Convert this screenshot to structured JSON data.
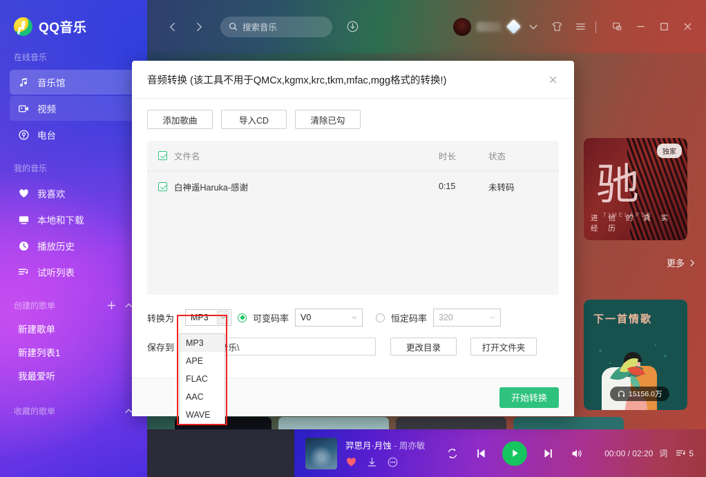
{
  "app": {
    "brand": "QQ音乐",
    "logo_icon": "qq-music-logo"
  },
  "sidebar": {
    "sections": [
      {
        "title": "在线音乐",
        "items": [
          {
            "label": "音乐馆",
            "icon": "music-note-icon",
            "state": "active"
          },
          {
            "label": "视频",
            "icon": "video-icon",
            "state": "semi"
          },
          {
            "label": "电台",
            "icon": "radio-icon",
            "state": "normal"
          }
        ]
      },
      {
        "title": "我的音乐",
        "items": [
          {
            "label": "我喜欢",
            "icon": "heart-icon",
            "state": "normal"
          },
          {
            "label": "本地和下载",
            "icon": "monitor-icon",
            "state": "normal"
          },
          {
            "label": "播放历史",
            "icon": "clock-icon",
            "state": "normal"
          },
          {
            "label": "试听列表",
            "icon": "playlist-icon",
            "state": "normal"
          }
        ]
      },
      {
        "title": "创建的歌单",
        "actions": [
          "plus-icon",
          "chevron-up-icon"
        ],
        "plain_items": [
          "新建歌单",
          "新建列表1",
          "我最爱听"
        ]
      },
      {
        "title": "收藏的歌单",
        "actions": [
          "chevron-up-icon"
        ],
        "plain_items": []
      }
    ]
  },
  "topbar": {
    "back_icon": "chevron-left-icon",
    "forward_icon": "chevron-right-icon",
    "search_placeholder": "搜索音乐",
    "search_icon": "search-icon",
    "download_icon": "download-circle-icon",
    "avatar_icon": "avatar",
    "vip_icon": "diamond-icon",
    "dropdown_icon": "chevron-down-icon",
    "skin_icon": "tshirt-icon",
    "menu_icon": "hamburger-icon",
    "mini_icon": "mini-window-icon",
    "minimize_icon": "minimize-icon",
    "maximize_icon": "maximize-icon",
    "close_icon": "close-icon"
  },
  "content": {
    "card_a": {
      "big_char": "驰",
      "latin": "TIMELAPSE",
      "sub": "进 他 的 真 实 经 历",
      "badge": "独家"
    },
    "more": {
      "label": "更多",
      "icon": "chevron-right-icon"
    },
    "card_b": {
      "title": "下一首情歌",
      "plays": "15156.0万",
      "plays_icon": "headphone-icon"
    }
  },
  "dialog": {
    "title": "音频转换 (该工具不用于QMCx,kgmx,krc,tkm,mfac,mgg格式的转换!)",
    "close_icon": "close-icon",
    "toolbar": [
      {
        "label": "添加歌曲",
        "name": "add-song-button"
      },
      {
        "label": "导入CD",
        "name": "import-cd-button"
      },
      {
        "label": "清除已勾",
        "name": "clear-checked-button"
      }
    ],
    "filelist": {
      "headers": {
        "name": "文件名",
        "duration": "时长",
        "status": "状态"
      },
      "header_checked": true,
      "rows": [
        {
          "checked": true,
          "name": "白神遥Haruka-感谢",
          "duration": "0:15",
          "status": "未转码"
        }
      ]
    },
    "form": {
      "convert_to_label": "转换为",
      "format_value": "MP3",
      "format_options": [
        "MP3",
        "APE",
        "FLAC",
        "AAC",
        "WAVE"
      ],
      "format_selected": "MP3",
      "vbr": {
        "label": "可变码率",
        "selected": true,
        "value": "V0"
      },
      "cbr": {
        "label": "恒定码率",
        "selected": false,
        "value": "320"
      },
      "save_to_label": "保存到",
      "save_path": "录\\我的音乐\\",
      "change_dir_label": "更改目录",
      "open_folder_label": "打开文件夹"
    },
    "footer": {
      "start_label": "开始转换"
    },
    "highlight_color": "#f02020",
    "accent_color": "#2ec27e"
  },
  "player": {
    "track_title": "羿思月·月蚀",
    "track_sep": "-",
    "track_artist": "周亦敏",
    "like_icon": "heart-filled-icon",
    "download_icon": "download-arrow-icon",
    "more_icon": "ellipsis-icon",
    "repeat_icon": "repeat-icon",
    "prev_icon": "previous-icon",
    "play_icon": "play-icon",
    "next_icon": "next-icon",
    "volume_icon": "volume-icon",
    "time_current": "00:00",
    "time_total": "02:20",
    "time_display": "00:00 / 02:20",
    "lyrics_icon": "词",
    "queue_icon": "queue-icon",
    "queue_count": "5"
  }
}
